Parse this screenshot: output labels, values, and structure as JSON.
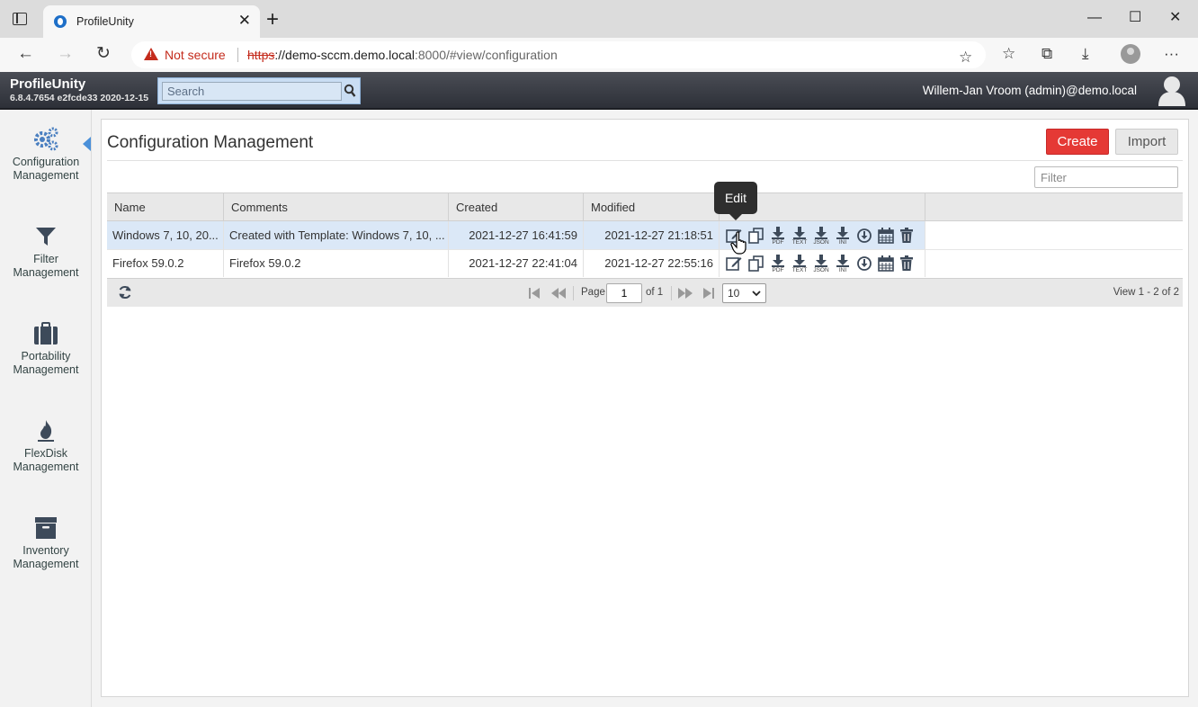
{
  "browser": {
    "tab_title": "ProfileUnity",
    "security_label": "Not secure",
    "url_scheme": "https",
    "url_host": "://demo-sccm.demo.local",
    "url_rest": ":8000/#view/configuration"
  },
  "header": {
    "brand": "ProfileUnity",
    "version": "6.8.4.7654 e2fcde33 2020-12-15",
    "search_placeholder": "Search",
    "user": "Willem-Jan Vroom (admin)@demo.local"
  },
  "sidebar": {
    "items": [
      {
        "label1": "Configuration",
        "label2": "Management",
        "icon": "gears-icon",
        "active": true
      },
      {
        "label1": "Filter",
        "label2": "Management",
        "icon": "filter-icon"
      },
      {
        "label1": "Portability",
        "label2": "Management",
        "icon": "briefcase-icon"
      },
      {
        "label1": "FlexDisk",
        "label2": "Management",
        "icon": "flame-icon"
      },
      {
        "label1": "Inventory",
        "label2": "Management",
        "icon": "archive-icon"
      }
    ]
  },
  "main": {
    "title": "Configuration Management",
    "create_label": "Create",
    "import_label": "Import",
    "filter_placeholder": "Filter",
    "columns": [
      "Name",
      "Comments",
      "Created",
      "Modified"
    ],
    "rows": [
      {
        "name": "Windows 7, 10, 20...",
        "comments": "Created with Template: Windows 7, 10, ...",
        "created": "2021-12-27 16:41:59",
        "modified": "2021-12-27 21:18:51",
        "selected": true
      },
      {
        "name": "Firefox 59.0.2",
        "comments": "Firefox 59.0.2",
        "created": "2021-12-27 22:41:04",
        "modified": "2021-12-27 22:55:16",
        "selected": false
      }
    ],
    "action_captions": {
      "pdf": "PDF",
      "text": "TEXT",
      "json": "JSON",
      "ini": "INI"
    },
    "tooltip": "Edit"
  },
  "pager": {
    "page_label": "Page",
    "page_value": "1",
    "of_label": "of 1",
    "rows_per_page": "10",
    "view_info": "View 1 - 2 of 2"
  },
  "colors": {
    "accent": "#e53935",
    "header_dark": "#2d3038",
    "selected_row": "#dbe8f7"
  }
}
